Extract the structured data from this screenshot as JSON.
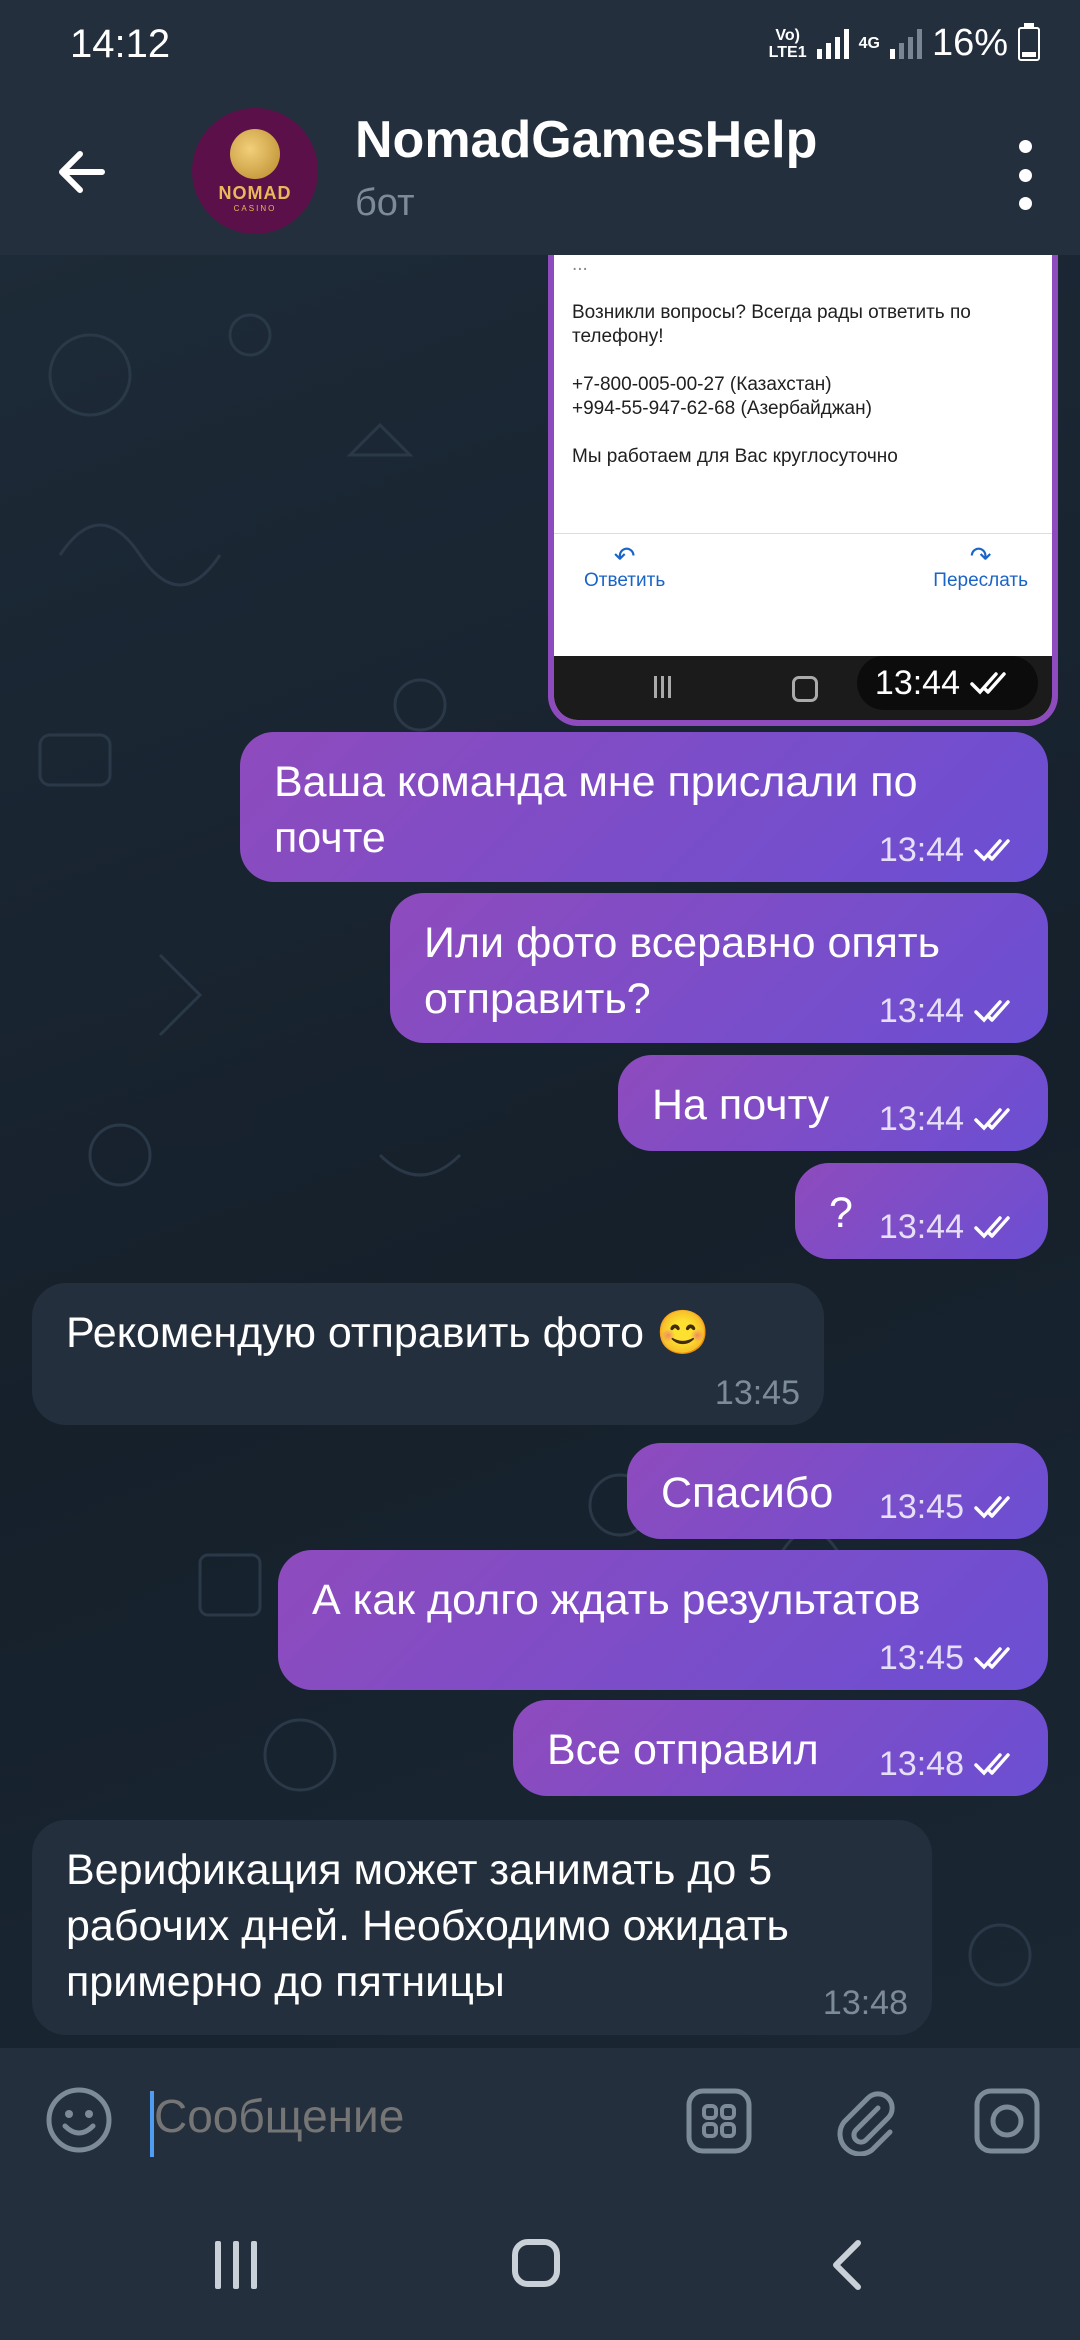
{
  "status_bar": {
    "time": "14:12",
    "network_label_top": "Vo)",
    "network_label_bottom": "LTE1",
    "network_4g": "4G",
    "battery": "16%"
  },
  "header": {
    "title": "NomadGamesHelp",
    "subtitle": "бот",
    "avatar_text": "NOMAD",
    "avatar_subtext": "CASINO"
  },
  "image_message": {
    "line_partial": "...",
    "paragraph1": "Возникли вопросы? Всегда рады ответить по телефону!",
    "phone1": "+7-800-005-00-27 (Казахстан)",
    "phone2": "+994-55-947-62-68 (Азербайджан)",
    "paragraph3": "Мы работаем для Вас круглосуточно",
    "reply_label": "Ответить",
    "forward_label": "Переслать",
    "time": "13:44"
  },
  "messages": [
    {
      "direction": "out",
      "text_line1": "Ваша команда мне прислали по",
      "text_line2": "почте",
      "time": "13:44"
    },
    {
      "direction": "out",
      "text_line1": "Или фото всеравно опять",
      "text_line2": "отправить?",
      "time": "13:44"
    },
    {
      "direction": "out",
      "text_line1": "На почту",
      "time": "13:44"
    },
    {
      "direction": "out",
      "text_line1": "?",
      "time": "13:44"
    },
    {
      "direction": "in",
      "text_line1": "Рекомендую отправить фото 😊",
      "time": "13:45"
    },
    {
      "direction": "out",
      "text_line1": "Спасибо",
      "time": "13:45"
    },
    {
      "direction": "out",
      "text_line1": "А как долго ждать результатов",
      "time": "13:45"
    },
    {
      "direction": "out",
      "text_line1": "Все отправил",
      "time": "13:48"
    },
    {
      "direction": "in",
      "text_line1": "Верификация может занимать до 5",
      "text_line2": "рабочих дней. Необходимо ожидать",
      "text_line3": "примерно до пятницы",
      "time": "13:48"
    }
  ],
  "input": {
    "placeholder": "Сообщение"
  },
  "icons": {
    "back": "arrow-left-icon",
    "menu": "more-vertical-icon",
    "emoji": "smiley-icon",
    "bot_commands": "grid-icon",
    "attach": "paperclip-icon",
    "camera": "camera-icon",
    "read_ticks": "double-check-icon"
  },
  "colors": {
    "outgoing_bubble": "#8e4bbd",
    "incoming_bubble": "#242f3d",
    "header_bg": "#242f3d",
    "accent_caret": "#4f9df2"
  }
}
